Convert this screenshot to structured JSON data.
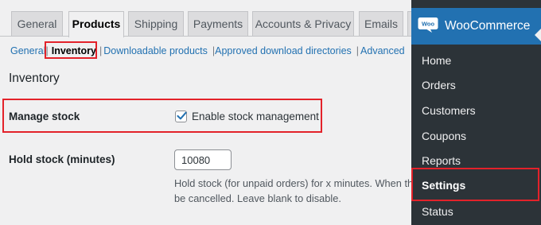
{
  "tabs": [
    {
      "label": "General"
    },
    {
      "label": "Products"
    },
    {
      "label": "Shipping"
    },
    {
      "label": "Payments"
    },
    {
      "label": "Accounts & Privacy"
    },
    {
      "label": "Emails"
    }
  ],
  "subnav": {
    "items": [
      {
        "label": "General"
      },
      {
        "label": "Inventory"
      },
      {
        "label": "Downloadable products"
      },
      {
        "label": "Approved download directories"
      },
      {
        "label": "Advanced"
      }
    ],
    "separator": "|"
  },
  "section": {
    "title": "Inventory"
  },
  "manage_stock": {
    "label": "Manage stock",
    "checkbox_label": "Enable stock management",
    "checked": true
  },
  "hold_stock": {
    "label": "Hold stock (minutes)",
    "value": "10080",
    "description_line1": "Hold stock (for unpaid orders) for x minutes. When thi",
    "description_line2": "be cancelled. Leave blank to disable."
  },
  "sidebar": {
    "logo_text": "Woo",
    "title": "WooCommerce",
    "items": [
      {
        "label": "Home"
      },
      {
        "label": "Orders"
      },
      {
        "label": "Customers"
      },
      {
        "label": "Coupons"
      },
      {
        "label": "Reports"
      },
      {
        "label": "Settings"
      },
      {
        "label": "Status"
      }
    ],
    "current": "Settings"
  },
  "colors": {
    "accent": "#2271b1",
    "highlight": "#e3222a",
    "sidebar_bg": "#2c3338",
    "page_bg": "#f0f0f1"
  }
}
